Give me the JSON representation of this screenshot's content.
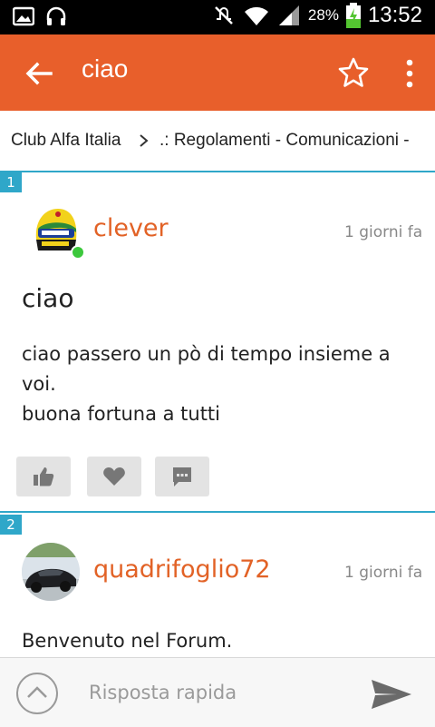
{
  "status_bar": {
    "battery_percent": "28%",
    "time": "13:52"
  },
  "app_bar": {
    "title": "ciao"
  },
  "breadcrumb": {
    "items": [
      "Club Alfa Italia",
      ".: Regolamenti - Comunicazioni -"
    ]
  },
  "posts": [
    {
      "number": "1",
      "username": "clever",
      "time_ago": "1 giorni fa",
      "title": "ciao",
      "body": [
        "ciao passero un pò di tempo insieme a voi.",
        "buona fortuna a tutti"
      ]
    },
    {
      "number": "2",
      "username": "quadrifoglio72",
      "time_ago": "1 giorni fa",
      "body": "Benvenuto nel Forum."
    }
  ],
  "reply_bar": {
    "placeholder": "Risposta rapida"
  },
  "colors": {
    "accent": "#e85f2b",
    "username": "#e26226",
    "post_number": "#2fa7c9"
  }
}
